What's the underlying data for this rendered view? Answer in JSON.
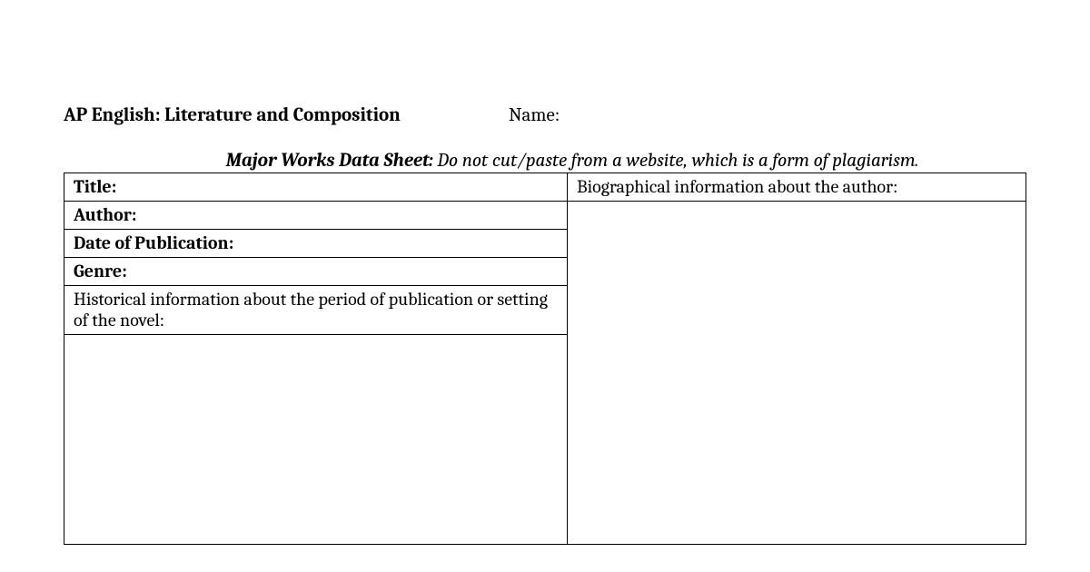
{
  "header": {
    "course": "AP English:  Literature and Composition",
    "nameLabel": "Name:"
  },
  "sheetTitle": {
    "bold": "Major Works Data Sheet:",
    "instruction": " Do not cut/paste from a website, which is a form of plagiarism."
  },
  "leftFields": {
    "title": "Title:",
    "author": "Author:",
    "dateOfPublication": "Date of Publication:",
    "genre": "Genre:",
    "historical": "Historical information about the period of publication or setting of the novel:"
  },
  "rightFields": {
    "biographical": "Biographical information about the author:"
  }
}
